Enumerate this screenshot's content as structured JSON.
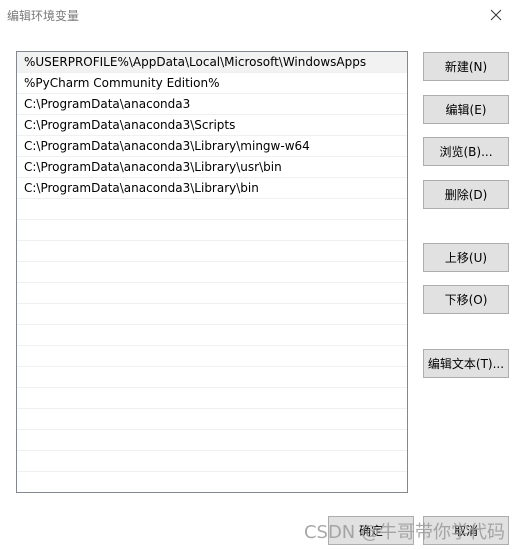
{
  "window": {
    "title": "编辑环境变量"
  },
  "paths": [
    "%USERPROFILE%\\AppData\\Local\\Microsoft\\WindowsApps",
    "%PyCharm Community Edition%",
    "C:\\ProgramData\\anaconda3",
    "C:\\ProgramData\\anaconda3\\Scripts",
    "C:\\ProgramData\\anaconda3\\Library\\mingw-w64",
    "C:\\ProgramData\\anaconda3\\Library\\usr\\bin",
    "C:\\ProgramData\\anaconda3\\Library\\bin"
  ],
  "buttons": {
    "new": "新建(N)",
    "edit": "编辑(E)",
    "browse": "浏览(B)...",
    "delete": "删除(D)",
    "move_up": "上移(U)",
    "move_down": "下移(O)",
    "edit_text": "编辑文本(T)...",
    "ok": "确定",
    "cancel": "取消"
  },
  "watermark": "CSDN @牛哥带你学代码",
  "colors": {
    "list_border": "#828790",
    "button_bg": "#e1e1e1",
    "button_border": "#adadad",
    "selected_row": "#f2f2f2"
  }
}
